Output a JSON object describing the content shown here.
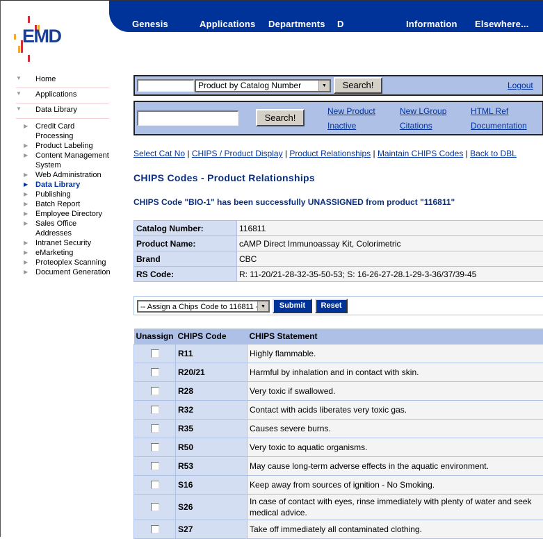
{
  "header": {
    "logo_text": "EMD",
    "nav": [
      "Genesis",
      "Applications",
      "Departments",
      "D",
      "Information",
      "Elsewhere..."
    ]
  },
  "sidebar": {
    "top_items": [
      {
        "label": "Home"
      },
      {
        "label": "Applications"
      },
      {
        "label": "Data Library"
      }
    ],
    "sub_items": [
      {
        "label": "Credit Card Processing"
      },
      {
        "label": "Product Labeling"
      },
      {
        "label": "Content Management System"
      },
      {
        "label": "Web Administration"
      },
      {
        "label": "Data Library",
        "active": true
      },
      {
        "label": "Publishing"
      },
      {
        "label": "Batch Report"
      },
      {
        "label": "Employee Directory"
      },
      {
        "label": "Sales Office Addresses"
      },
      {
        "label": "Intranet Security"
      },
      {
        "label": "eMarketing"
      },
      {
        "label": "Proteoplex Scanning"
      },
      {
        "label": "Document Generation"
      }
    ]
  },
  "search1": {
    "input_value": "",
    "select_value": "Product by Catalog Number",
    "search_label": "Search!",
    "logout_label": "Logout"
  },
  "search2": {
    "input_value": "",
    "search_label": "Search!",
    "links": [
      "New Product",
      "New LGroup",
      "HTML Ref",
      "Inactive",
      "Citations",
      "Documentation"
    ]
  },
  "breadcrumbs": [
    "Select Cat No",
    "CHIPS / Product Display",
    "Product Relationships",
    "Maintain CHIPS Codes",
    "Back to DBL"
  ],
  "breadcrumb_separator": "|",
  "page_title": "CHIPS Codes - Product Relationships",
  "status_message": "CHIPS Code \"BIO-1\" has been successfully UNASSIGNED from product \"116811\"",
  "product": {
    "rows": [
      {
        "label": "Catalog Number:",
        "value": "116811"
      },
      {
        "label": "Product Name:",
        "value": "cAMP Direct Immunoassay Kit, Colorimetric"
      },
      {
        "label": "Brand",
        "value": "CBC"
      },
      {
        "label": "RS Code:",
        "value": "R: 11-20/21-28-32-35-50-53; S: 16-26-27-28.1-29-3-36/37/39-45"
      }
    ]
  },
  "assign": {
    "select_value": "-- Assign a Chips Code to 116811 --",
    "submit_label": "Submit",
    "reset_label": "Reset"
  },
  "chips_table": {
    "headers": [
      "Unassign",
      "CHIPS Code",
      "CHIPS Statement"
    ],
    "rows": [
      {
        "code": "R11",
        "statement": "Highly flammable.",
        "checked": false
      },
      {
        "code": "R20/21",
        "statement": "Harmful by inhalation and in contact with skin.",
        "checked": false
      },
      {
        "code": "R28",
        "statement": "Very toxic if swallowed.",
        "checked": false
      },
      {
        "code": "R32",
        "statement": "Contact with acids liberates very toxic gas.",
        "checked": false
      },
      {
        "code": "R35",
        "statement": "Causes severe burns.",
        "checked": false
      },
      {
        "code": "R50",
        "statement": "Very toxic to aquatic organisms.",
        "checked": false
      },
      {
        "code": "R53",
        "statement": "May cause long-term adverse effects in the aquatic environment.",
        "checked": false
      },
      {
        "code": "S16",
        "statement": "Keep away from sources of ignition - No Smoking.",
        "checked": false
      },
      {
        "code": "S26",
        "statement": "In case of contact with eyes, rinse immediately with plenty of water and seek medical advice.",
        "checked": false
      },
      {
        "code": "S27",
        "statement": "Take off immediately all contaminated clothing.",
        "checked": false
      }
    ]
  },
  "colors": {
    "brand_blue": "#00339a",
    "panel_blue": "#aec0e6",
    "cell_blue": "#d4def2",
    "logo_red": "#d0303a",
    "logo_orange": "#f0a830"
  }
}
